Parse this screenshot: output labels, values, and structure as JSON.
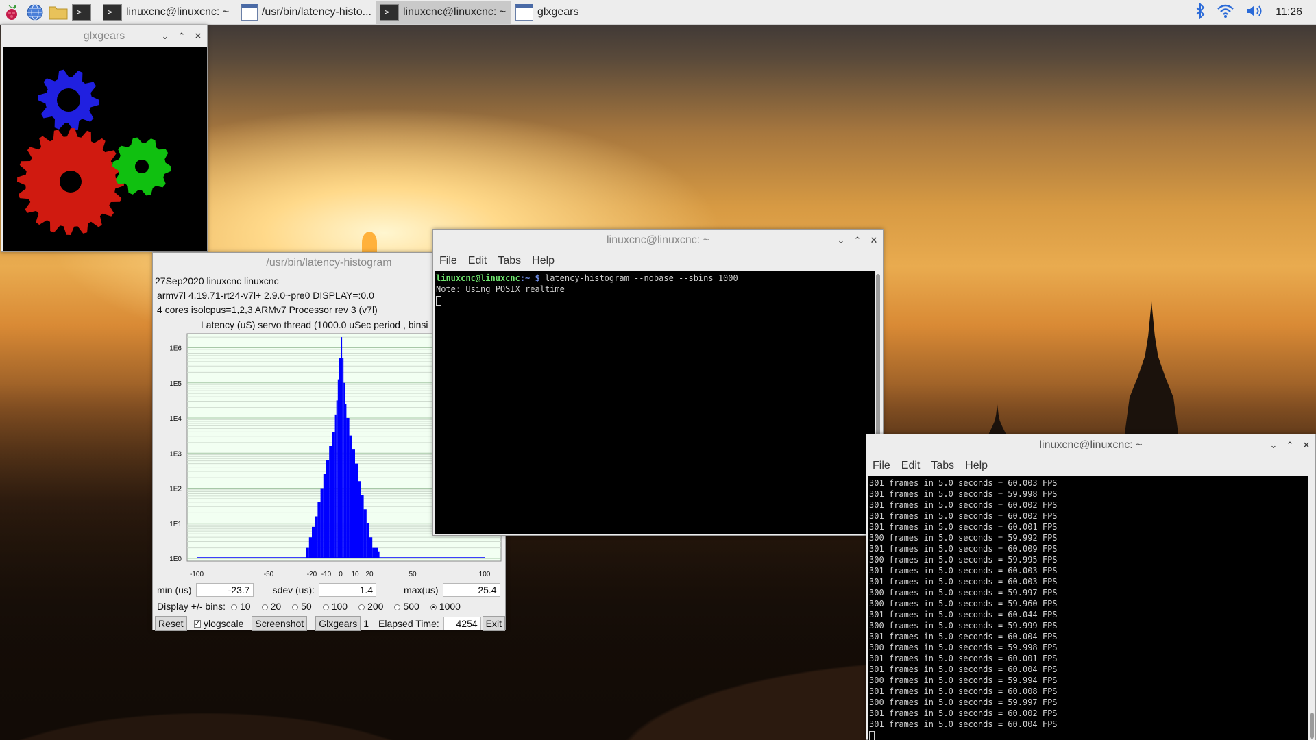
{
  "taskbar": {
    "tasks": [
      {
        "label": "linuxcnc@linuxcnc: ~"
      },
      {
        "label": "/usr/bin/latency-histo..."
      },
      {
        "label": "linuxcnc@linuxcnc: ~"
      },
      {
        "label": "glxgears"
      }
    ],
    "clock": "11:26",
    "icons": [
      "raspberry-menu-icon",
      "browser-icon",
      "file-manager-icon",
      "terminal-icon",
      "bluetooth-icon",
      "wifi-icon",
      "volume-icon"
    ]
  },
  "glxgears_window": {
    "title": "glxgears",
    "gear_colors": [
      "#2020e0",
      "#d01a10",
      "#10c010"
    ]
  },
  "histogram_window": {
    "title": "/usr/bin/latency-histogram",
    "info_line1": "27Sep2020 linuxcnc linuxcnc",
    "info_line2": "armv7l  4.19.71-rt24-v7l+  2.9.0~pre0  DISPLAY=:0.0",
    "info_line3": "4 cores  isolcpus=1,2,3    ARMv7 Processor rev 3 (v7l)",
    "plot_title": "Latency (uS) servo thread (1000.0 uSec period , binsi",
    "min_label": "min (us)",
    "min_value": "-23.7",
    "sdev_label": "sdev (us):",
    "sdev_value": "1.4",
    "max_label": "max(us)",
    "max_value": "25.4",
    "bins_label": "Display +/- bins:",
    "bins_options": [
      "10",
      "20",
      "50",
      "100",
      "200",
      "500",
      "1000"
    ],
    "bins_selected": "1000",
    "reset_label": "Reset",
    "ylogscale_label": "ylogscale",
    "ylogscale_checked": true,
    "screenshot_label": "Screenshot",
    "glxgears_label": "Glxgears",
    "glxgears_count": "1",
    "elapsed_label": "Elapsed Time:",
    "elapsed_value": "4254",
    "exit_label": "Exit"
  },
  "chart_data": {
    "type": "bar",
    "title": "Latency (uS) servo thread (1000.0 uSec period , binsi",
    "xlabel": "",
    "ylabel": "",
    "x_ticks": [
      "-100",
      "-50",
      "-20",
      "-10",
      "0",
      "10",
      "20",
      "50",
      "100"
    ],
    "x_tick_values": [
      -100,
      -50,
      -20,
      -10,
      0,
      10,
      20,
      50,
      100
    ],
    "y_ticks": [
      "1E0",
      "1E1",
      "1E2",
      "1E3",
      "1E4",
      "1E5",
      "1E6"
    ],
    "xlim": [
      -100,
      100
    ],
    "ylim_log10": [
      0,
      6.4
    ],
    "log_scale_y": true,
    "bar_color": "#0000ff",
    "series": [
      {
        "x": [
          -24,
          -22,
          -20,
          -18,
          -16,
          -14,
          -12,
          -10,
          -8,
          -6,
          -4,
          -3,
          -2,
          -1,
          0,
          1,
          2,
          3,
          4,
          6,
          8,
          10,
          12,
          14,
          16,
          18,
          20,
          22,
          26
        ],
        "log10_counts": [
          0.3,
          0.6,
          0.9,
          1.2,
          1.6,
          2.0,
          2.4,
          2.8,
          3.2,
          3.6,
          4.1,
          4.5,
          5.1,
          5.7,
          6.3,
          5.7,
          5.0,
          4.4,
          4.0,
          3.5,
          3.1,
          2.7,
          2.2,
          1.8,
          1.4,
          1.0,
          0.6,
          0.3,
          0.2
        ]
      }
    ]
  },
  "terminal1": {
    "title": "linuxcnc@linuxcnc: ~",
    "menu": [
      "File",
      "Edit",
      "Tabs",
      "Help"
    ],
    "prompt_user": "linuxcnc@linuxcnc",
    "prompt_path": ":~ $",
    "command": "latency-histogram --nobase --sbins 1000",
    "output": "Note: Using POSIX realtime"
  },
  "terminal2": {
    "title": "linuxcnc@linuxcnc: ~",
    "menu": [
      "File",
      "Edit",
      "Tabs",
      "Help"
    ],
    "lines": [
      "301 frames in 5.0 seconds = 60.003 FPS",
      "301 frames in 5.0 seconds = 59.998 FPS",
      "301 frames in 5.0 seconds = 60.002 FPS",
      "301 frames in 5.0 seconds = 60.002 FPS",
      "301 frames in 5.0 seconds = 60.001 FPS",
      "300 frames in 5.0 seconds = 59.992 FPS",
      "301 frames in 5.0 seconds = 60.009 FPS",
      "300 frames in 5.0 seconds = 59.995 FPS",
      "301 frames in 5.0 seconds = 60.003 FPS",
      "301 frames in 5.0 seconds = 60.003 FPS",
      "300 frames in 5.0 seconds = 59.997 FPS",
      "300 frames in 5.0 seconds = 59.960 FPS",
      "301 frames in 5.0 seconds = 60.044 FPS",
      "300 frames in 5.0 seconds = 59.999 FPS",
      "301 frames in 5.0 seconds = 60.004 FPS",
      "300 frames in 5.0 seconds = 59.998 FPS",
      "301 frames in 5.0 seconds = 60.001 FPS",
      "301 frames in 5.0 seconds = 60.004 FPS",
      "300 frames in 5.0 seconds = 59.994 FPS",
      "301 frames in 5.0 seconds = 60.008 FPS",
      "300 frames in 5.0 seconds = 59.997 FPS",
      "301 frames in 5.0 seconds = 60.002 FPS",
      "301 frames in 5.0 seconds = 60.004 FPS"
    ]
  }
}
